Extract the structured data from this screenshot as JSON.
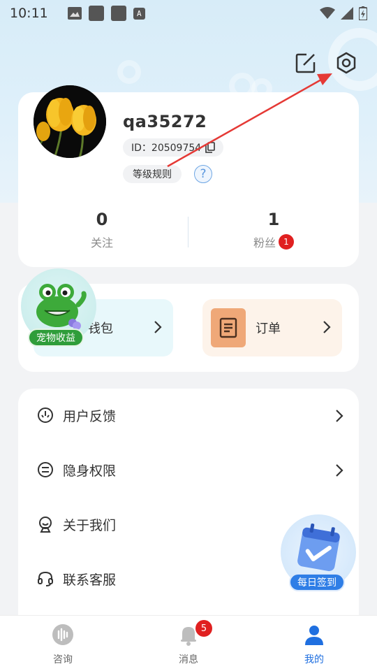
{
  "status_bar": {
    "time": "10:11",
    "a_icon": "A"
  },
  "header_actions": {
    "edit_icon": "edit-icon",
    "settings_icon": "settings-gear-icon"
  },
  "profile": {
    "username": "qa35272",
    "id_text": "ID：20509754",
    "level_rules": "等级规则",
    "help_symbol": "?",
    "following": {
      "count": "0",
      "label": "关注"
    },
    "followers": {
      "count": "1",
      "label": "粉丝",
      "badge": "1"
    }
  },
  "tiles": {
    "wallet": {
      "label": "钱包"
    },
    "orders": {
      "label": "订单"
    }
  },
  "pet": {
    "label": "宠物收益"
  },
  "menu": {
    "items": [
      {
        "label": "用户反馈",
        "icon": "feedback-icon",
        "has_arrow": true
      },
      {
        "label": "隐身权限",
        "icon": "invisible-icon",
        "has_arrow": true
      },
      {
        "label": "关于我们",
        "icon": "about-icon",
        "has_arrow": false
      },
      {
        "label": "联系客服",
        "icon": "headset-icon",
        "has_arrow": false
      }
    ]
  },
  "daily_signin": {
    "label": "每日签到"
  },
  "tabbar": {
    "tabs": [
      {
        "label": "咨询",
        "icon": "consult-icon",
        "active": false
      },
      {
        "label": "消息",
        "icon": "bell-icon",
        "active": false,
        "badge": "5"
      },
      {
        "label": "我的",
        "icon": "user-icon",
        "active": true
      }
    ]
  },
  "colors": {
    "accent_blue": "#1f6fe0",
    "badge_red": "#e02020",
    "pet_green": "#2f9d3a",
    "annotation_red": "#e53935"
  }
}
